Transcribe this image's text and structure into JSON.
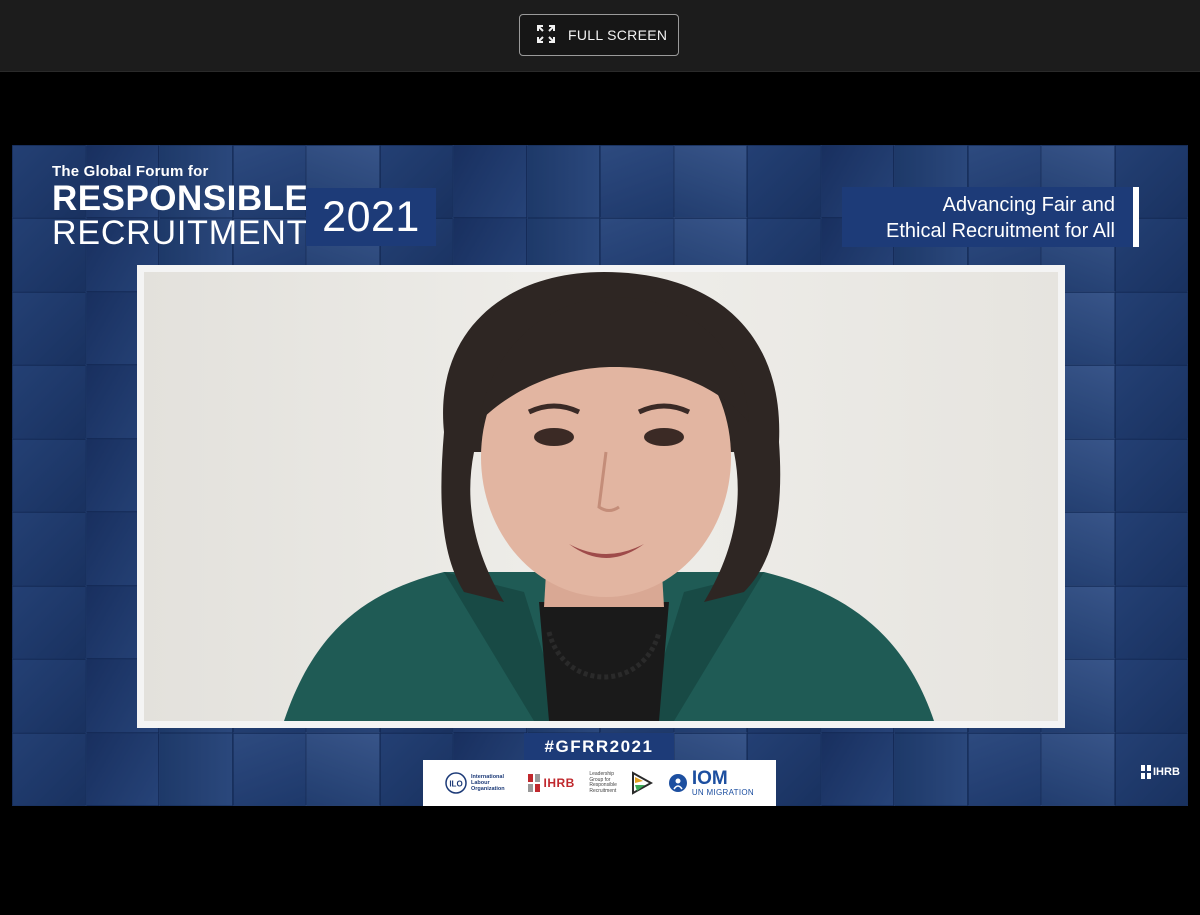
{
  "toolbar": {
    "fullscreen_label": "FULL SCREEN",
    "fullscreen_icon": "expand-arrows-icon"
  },
  "event": {
    "kicker": "The Global Forum for",
    "title_line1": "RESPONSIBLE",
    "title_line2": "RECRUITMENT",
    "year": "2021",
    "tagline_line1": "Advancing Fair and",
    "tagline_line2": "Ethical Recruitment for All",
    "hashtag": "#GFRR2021"
  },
  "sponsors": {
    "ilo": "International Labour Organization",
    "ihrb": "IHRB",
    "lgrr": "Leadership Group for Responsible Recruitment",
    "iom": "IOM",
    "iom_sub": "UN MIGRATION"
  },
  "corner_logo": "IHRB",
  "colors": {
    "accent_navy": "#1d3b78",
    "stage_bg": "#1d3765",
    "topbar": "#1c1c1c"
  }
}
